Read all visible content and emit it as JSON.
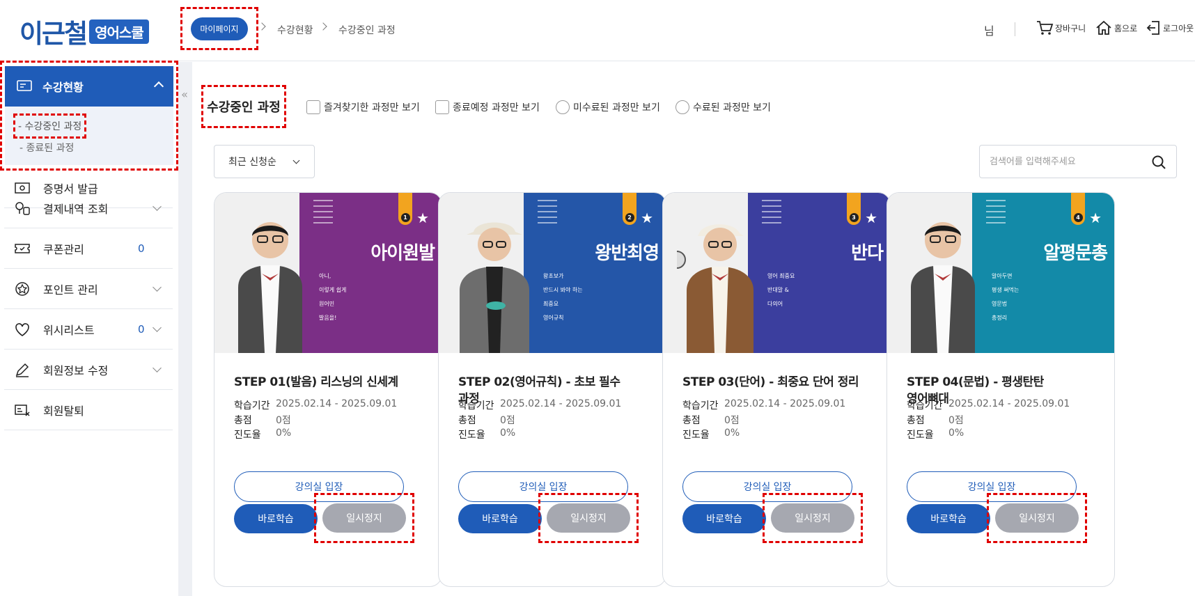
{
  "header": {
    "logo_text": "이근철",
    "logo_badge": "영어스쿨",
    "breadcrumb": [
      "마이페이지",
      "수강현황",
      "수강중인 과정"
    ],
    "user_suffix": "님",
    "links": {
      "cart": "장바구니",
      "home": "홈으로",
      "logout": "로그아웃"
    }
  },
  "sidebar": {
    "active_section": "수강현황",
    "sub_items": [
      "- 수강중인 과정",
      "- 종료된 과정"
    ],
    "items": [
      {
        "label": "증명서 발급",
        "icon": "certificate-icon",
        "count": "",
        "expandable": false
      },
      {
        "label": "결제내역 조회",
        "icon": "payment-icon",
        "count": "",
        "expandable": true
      },
      {
        "label": "쿠폰관리",
        "icon": "coupon-icon",
        "count": "0",
        "expandable": false
      },
      {
        "label": "포인트 관리",
        "icon": "point-icon",
        "count": "",
        "expandable": true
      },
      {
        "label": "위시리스트",
        "icon": "heart-icon",
        "count": "0",
        "expandable": true
      },
      {
        "label": "회원정보 수정",
        "icon": "pencil-icon",
        "count": "",
        "expandable": true
      },
      {
        "label": "회원탈퇴",
        "icon": "withdraw-icon",
        "count": "",
        "expandable": false
      }
    ]
  },
  "main": {
    "title": "수강중인 과정",
    "filters": [
      {
        "label": "즐겨찾기한 과정만 보기",
        "type": "checkbox"
      },
      {
        "label": "종료예정 과정만 보기",
        "type": "checkbox"
      },
      {
        "label": "미수료된 과정만 보기",
        "type": "radio"
      },
      {
        "label": "수료된 과정만 보기",
        "type": "radio"
      }
    ],
    "sort": "최근 신청순",
    "search_placeholder": "검색어를 입력해주세요",
    "labels": {
      "period": "학습기간",
      "score": "총점",
      "progress": "진도율"
    },
    "buttons": {
      "enter": "강의실 입장",
      "study": "바로학습",
      "pause": "일시정지"
    },
    "courses": [
      {
        "step": "1",
        "cover_title": "아이원발",
        "cover_color": "#7b2f86",
        "cover_lines": [
          "아니,",
          "이렇게 쉽게",
          "원어민",
          "발음을!"
        ],
        "title_line1": "STEP 01(발음) 리스닝의 신세계",
        "title_line2": "",
        "period": "2025.02.14 - 2025.09.01",
        "score": "0점",
        "progress": "0%"
      },
      {
        "step": "2",
        "cover_title": "왕반최영",
        "cover_color": "#2456a8",
        "cover_lines": [
          "왕초보가",
          "반드시 봐야 하는",
          "최중요",
          "영어규칙"
        ],
        "title_line1": "STEP 02(영어규칙) - 초보 필수",
        "title_line2": "과정",
        "period": "2025.02.14 - 2025.09.01",
        "score": "0점",
        "progress": "0%"
      },
      {
        "step": "3",
        "cover_title": "반다",
        "cover_color": "#3b3e9e",
        "cover_lines": [
          "영어 최중요",
          "반대말 &",
          "다의어"
        ],
        "title_line1": "STEP 03(단어) - 최중요 단어 정리",
        "title_line2": "",
        "period": "2025.02.14 - 2025.09.01",
        "score": "0점",
        "progress": "0%"
      },
      {
        "step": "4",
        "cover_title": "알평문총",
        "cover_color": "#138aa8",
        "cover_lines": [
          "알아두면",
          "평생 써먹는",
          "영문법",
          "총정리"
        ],
        "title_line1": "STEP 04(문법) - 평생탄탄",
        "title_line2": "영어뼈대",
        "period": "2025.02.14 - 2025.09.01",
        "score": "0점",
        "progress": "0%"
      }
    ]
  },
  "colors": {
    "primary": "#1f5cb8",
    "pause": "#a6a8b0",
    "highlight_dash": "#e00000"
  }
}
